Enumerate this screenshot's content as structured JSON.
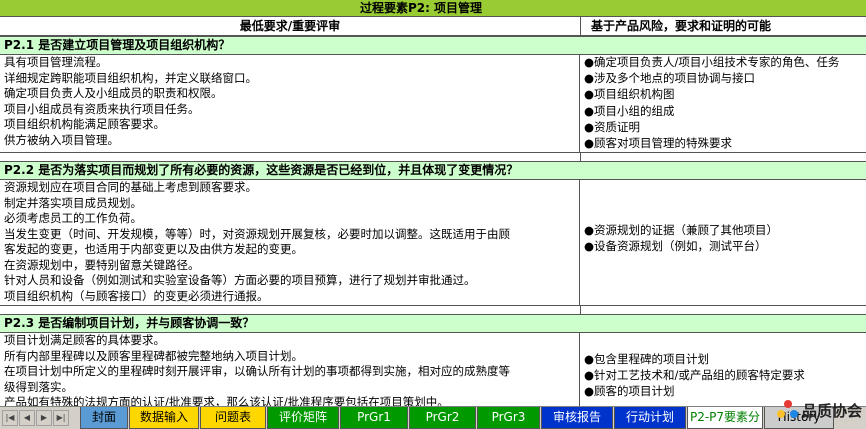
{
  "title": "过程要素P2: 项目管理",
  "header": {
    "req": "最低要求/重要评审",
    "risk": "基于产品风险，要求和证明的可能"
  },
  "sections": [
    {
      "title": "P2.1 是否建立项目管理及项目组织机构？",
      "req": [
        "具有项目管理流程。",
        "详细规定跨职能项目组织机构，并定义联络窗口。",
        "确定项目负责人及小组成员的职责和权限。",
        "项目小组成员有资质来执行项目任务。",
        "项目组织机构能满足顾客要求。",
        "供方被纳入项目管理。"
      ],
      "risk": [
        "●确定项目负责人/项目小组技术专家的角色、任务",
        "●涉及多个地点的项目协调与接口",
        "●项目组织机构图",
        "●项目小组的组成",
        "●资质证明",
        "●顾客对项目管理的特殊要求"
      ]
    },
    {
      "title": "P2.2 是否为落实项目而规划了所有必要的资源，这些资源是否已经到位，并且体现了变更情况？",
      "req": [
        "资源规划应在项目合同的基础上考虑到顾客要求。",
        "制定并落实项目成员规划。",
        "必须考虑员工的工作负荷。",
        "当发生变更（时间、开发规模，等等）时，对资源规划开展复核，必要时加以调整。这既适用于由顾",
        "客发起的变更，也适用于内部变更以及由供方发起的变更。",
        "在资源规划中，要特别留意关键路径。",
        "针对人员和设备（例如测试和实验室设备等）方面必要的项目预算，进行了规划并审批通过。",
        "项目组织机构（与顾客接口）的变更必须进行通报。"
      ],
      "risk": [
        "●资源规划的证据（兼顾了其他项目）",
        "●设备资源规划（例如，测试平台）"
      ]
    },
    {
      "title": "P2.3 是否编制项目计划，并与顾客协调一致？",
      "req": [
        "项目计划满足顾客的具体要求。",
        "所有内部里程碑以及顾客里程碑都被完整地纳入项目计划。",
        "在项目计划中所定义的里程碑时刻开展评审，以确认所有计划的事项都得到实施，相对应的成熟度等",
        "级得到落实。",
        "产品如有特殊的法规方面的认证/批准要求，那么该认证/批准程序要包括在项目策划中。"
      ],
      "risk": [
        "●包含里程碑的项目计划",
        "●针对工艺技术和/或产品组的顾客特定要求",
        "●顾客的项目计划"
      ]
    }
  ],
  "tabs": [
    {
      "label": "封面",
      "bg": "#5b9bd5",
      "color": "#000"
    },
    {
      "label": "数据输入",
      "bg": "#ffd700",
      "color": "#000"
    },
    {
      "label": "问题表",
      "bg": "#ffd700",
      "color": "#000"
    },
    {
      "label": "评价矩阵",
      "bg": "#009900",
      "color": "#fff"
    },
    {
      "label": "PrGr1",
      "bg": "#009900",
      "color": "#fff"
    },
    {
      "label": "PrGr2",
      "bg": "#009900",
      "color": "#fff"
    },
    {
      "label": "PrGr3",
      "bg": "#009900",
      "color": "#fff"
    },
    {
      "label": "审核报告",
      "bg": "#0033cc",
      "color": "#fff"
    },
    {
      "label": "行动计划",
      "bg": "#0033cc",
      "color": "#fff"
    },
    {
      "label": "P2-P7要素分",
      "bg": "#ffffff",
      "color": "#008000"
    },
    {
      "label": "History",
      "bg": "#cccccc",
      "color": "#000"
    }
  ],
  "logo": {
    "text": "品质协会"
  }
}
